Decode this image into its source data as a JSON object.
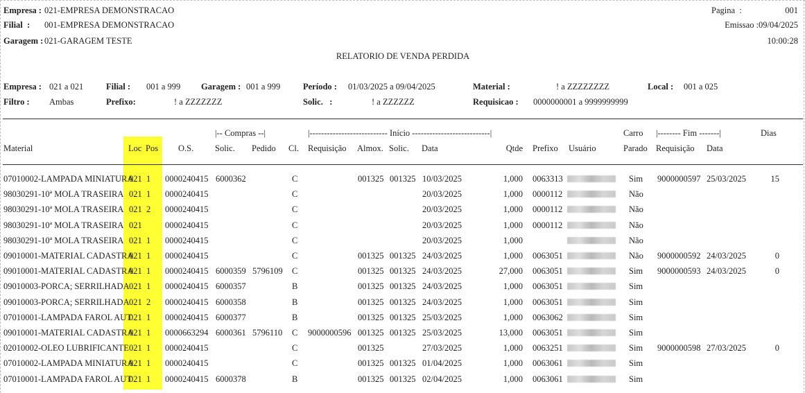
{
  "header": {
    "empresa_label": "Empresa :",
    "empresa_value": "021-EMPRESA DEMONSTRACAO",
    "filial_label": "Filial  :",
    "filial_value": "001-EMPRESA DEMONSTRACAO",
    "garagem_label": "Garagem :",
    "garagem_value": "021-GARAGEM TESTE",
    "pagina_label": "Pagina  :",
    "pagina_value": "001",
    "emissao": "Emissao :09/04/2025",
    "hora": "10:00:28",
    "title": "RELATORIO DE VENDA PERDIDA"
  },
  "filters": {
    "empresa_label": "Empresa :",
    "empresa_value": "021 a 021",
    "filial_label": "Filial :",
    "filial_value": "001 a 999",
    "garagem_label": "Garagem :",
    "garagem_value": "001 a 999",
    "periodo_label": "Período :",
    "periodo_value": "01/03/2025 a 09/04/2025",
    "material_label": "Material :",
    "material_value": "! a ZZZZZZZZ",
    "local_label": "Local :",
    "local_value": "001 a 025",
    "filtro_label": "Filtro :",
    "filtro_value": "Ambas",
    "prefixo_label": "Prefixo:",
    "prefixo_value": "! a ZZZZZZZ",
    "solic_label": "Solic.   :",
    "solic_value": "! a ZZZZZZ",
    "requisicao_label": "Requisicao :",
    "requisicao_value": "0000000001 a 9999999999"
  },
  "columns": {
    "group_compras": "|-- Compras --|",
    "group_inicio": "|--------------------------- Início ---------------------------|",
    "group_carro": "Carro",
    "group_fim": "|-------- Fim -------|",
    "group_dias": "Dias",
    "material": "Material",
    "loc": "Loc",
    "pos": "Pos",
    "os": "O.S.",
    "solic": "Solic.",
    "pedido": "Pedido",
    "cl": "Cl.",
    "requisicao": "Requisição",
    "almox": "Almox.",
    "solic2": "Solic.",
    "data": "Data",
    "qtde": "Qtde",
    "prefixo": "Prefixo",
    "usuario": "Usuário",
    "parado": "Parado",
    "fim_requisicao": "Requisição",
    "fim_data": "Data"
  },
  "rows": [
    {
      "material": "07010002-LAMPADA MINIATURA",
      "loc": "021",
      "pos": "1",
      "os": "0000240415",
      "solic": "6000362",
      "pedido": "",
      "cl": "C",
      "req": "",
      "almox": "001325",
      "solic2": "001325",
      "data": "10/03/2025",
      "qtde": "1,000",
      "prefixo": "0063313",
      "parado": "Sim",
      "fim_req": "9000000597",
      "fim_data": "25/03/2025",
      "dias": "15"
    },
    {
      "material": "98030291-10ª MOLA TRASEIRA",
      "loc": "021",
      "pos": "1",
      "os": "0000240415",
      "solic": "",
      "pedido": "",
      "cl": "C",
      "req": "",
      "almox": "",
      "solic2": "",
      "data": "20/03/2025",
      "qtde": "1,000",
      "prefixo": "0000112",
      "parado": "Não",
      "fim_req": "",
      "fim_data": "",
      "dias": ""
    },
    {
      "material": "98030291-10ª MOLA TRASEIRA",
      "loc": "021",
      "pos": "2",
      "os": "0000240415",
      "solic": "",
      "pedido": "",
      "cl": "C",
      "req": "",
      "almox": "",
      "solic2": "",
      "data": "20/03/2025",
      "qtde": "1,000",
      "prefixo": "0000112",
      "parado": "Não",
      "fim_req": "",
      "fim_data": "",
      "dias": ""
    },
    {
      "material": "98030291-10ª MOLA TRASEIRA",
      "loc": "021",
      "pos": "",
      "os": "0000240415",
      "solic": "",
      "pedido": "",
      "cl": "C",
      "req": "",
      "almox": "",
      "solic2": "",
      "data": "20/03/2025",
      "qtde": "1,000",
      "prefixo": "0000112",
      "parado": "Não",
      "fim_req": "",
      "fim_data": "",
      "dias": ""
    },
    {
      "material": "98030291-10ª MOLA TRASEIRA",
      "loc": "021",
      "pos": "1",
      "os": "0000240415",
      "solic": "",
      "pedido": "",
      "cl": "C",
      "req": "",
      "almox": "",
      "solic2": "",
      "data": "20/03/2025",
      "qtde": "1,000",
      "prefixo": "",
      "parado": "Não",
      "fim_req": "",
      "fim_data": "",
      "dias": ""
    },
    {
      "material": "09010001-MATERIAL CADASTRA",
      "loc": "021",
      "pos": "1",
      "os": "0000240415",
      "solic": "",
      "pedido": "",
      "cl": "C",
      "req": "",
      "almox": "001325",
      "solic2": "001325",
      "data": "24/03/2025",
      "qtde": "1,000",
      "prefixo": "0063051",
      "parado": "Não",
      "fim_req": "9000000592",
      "fim_data": "24/03/2025",
      "dias": "0"
    },
    {
      "material": "09010001-MATERIAL CADASTRA",
      "loc": "021",
      "pos": "1",
      "os": "0000240415",
      "solic": "6000359",
      "pedido": "5796109",
      "cl": "C",
      "req": "",
      "almox": "001325",
      "solic2": "001325",
      "data": "24/03/2025",
      "qtde": "27,000",
      "prefixo": "0063051",
      "parado": "Sim",
      "fim_req": "9000000593",
      "fim_data": "24/03/2025",
      "dias": "0"
    },
    {
      "material": "09010003-PORCA; SERRILHADA",
      "loc": "021",
      "pos": "1",
      "os": "0000240415",
      "solic": "6000357",
      "pedido": "",
      "cl": "B",
      "req": "",
      "almox": "001325",
      "solic2": "001325",
      "data": "24/03/2025",
      "qtde": "1,000",
      "prefixo": "0063051",
      "parado": "Sim",
      "fim_req": "",
      "fim_data": "",
      "dias": ""
    },
    {
      "material": "09010003-PORCA; SERRILHADA",
      "loc": "021",
      "pos": "2",
      "os": "0000240415",
      "solic": "6000358",
      "pedido": "",
      "cl": "B",
      "req": "",
      "almox": "001325",
      "solic2": "001325",
      "data": "24/03/2025",
      "qtde": "1,000",
      "prefixo": "0063051",
      "parado": "Sim",
      "fim_req": "",
      "fim_data": "",
      "dias": ""
    },
    {
      "material": "07010001-LAMPADA FAROL AUT",
      "loc": "021",
      "pos": "1",
      "os": "0000240415",
      "solic": "6000377",
      "pedido": "",
      "cl": "B",
      "req": "",
      "almox": "001325",
      "solic2": "001325",
      "data": "25/03/2025",
      "qtde": "1,000",
      "prefixo": "0063062",
      "parado": "Sim",
      "fim_req": "",
      "fim_data": "",
      "dias": ""
    },
    {
      "material": "09010001-MATERIAL CADASTRA",
      "loc": "021",
      "pos": "1",
      "os": "0000663294",
      "solic": "6000361",
      "pedido": "5796110",
      "cl": "C",
      "req": "9000000596",
      "almox": "001325",
      "solic2": "001325",
      "data": "25/03/2025",
      "qtde": "13,000",
      "prefixo": "0063051",
      "parado": "Sim",
      "fim_req": "",
      "fim_data": "",
      "dias": ""
    },
    {
      "material": "02010002-OLEO LUBRIFICANTE",
      "loc": "021",
      "pos": "1",
      "os": "0000240415",
      "solic": "",
      "pedido": "",
      "cl": "C",
      "req": "",
      "almox": "001325",
      "solic2": "",
      "data": "27/03/2025",
      "qtde": "1,000",
      "prefixo": "0063251",
      "parado": "Sim",
      "fim_req": "9000000598",
      "fim_data": "27/03/2025",
      "dias": "0"
    },
    {
      "material": "07010002-LAMPADA MINIATURA",
      "loc": "021",
      "pos": "1",
      "os": "0000240415",
      "solic": "",
      "pedido": "",
      "cl": "C",
      "req": "",
      "almox": "001325",
      "solic2": "001325",
      "data": "01/04/2025",
      "qtde": "1,000",
      "prefixo": "0063061",
      "parado": "Sim",
      "fim_req": "",
      "fim_data": "",
      "dias": ""
    },
    {
      "material": "07010001-LAMPADA FAROL AUT",
      "loc": "021",
      "pos": "1",
      "os": "0000240415",
      "solic": "6000378",
      "pedido": "",
      "cl": "B",
      "req": "",
      "almox": "001325",
      "solic2": "001325",
      "data": "02/04/2025",
      "qtde": "1,000",
      "prefixo": "0063061",
      "parado": "Sim",
      "fim_req": "",
      "fim_data": "",
      "dias": ""
    }
  ]
}
